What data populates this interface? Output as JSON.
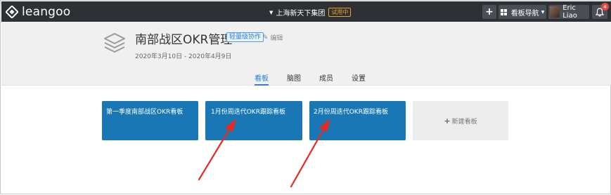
{
  "app": {
    "name": "leangoo"
  },
  "topbar": {
    "org_name": "上海新天下集团",
    "trial_badge": "试用中",
    "add_icon": "plus-icon",
    "nav_label": "看板导航",
    "user_name": "Eric Liao",
    "notification_count": "4"
  },
  "project": {
    "title": "南部战区OKR管理",
    "tag": "轻量级协作",
    "edit_label": "编辑",
    "date_range": "2020年3月10日 - 2020年4月9日"
  },
  "tabs": [
    {
      "label": "看板",
      "active": true
    },
    {
      "label": "脑图",
      "active": false
    },
    {
      "label": "成员",
      "active": false
    },
    {
      "label": "设置",
      "active": false
    }
  ],
  "boards": [
    {
      "name": "第一季度南部战区OKR看板"
    },
    {
      "name": "1月份周迭代OKR跟踪看板"
    },
    {
      "name": "2月份周迭代OKR跟踪看板"
    }
  ],
  "new_board_label": "新建看板",
  "colors": {
    "topbar": "#2d3035",
    "board": "#1877b4",
    "accent": "#2d7fd1",
    "annotation_arrow": "#e8291f"
  }
}
